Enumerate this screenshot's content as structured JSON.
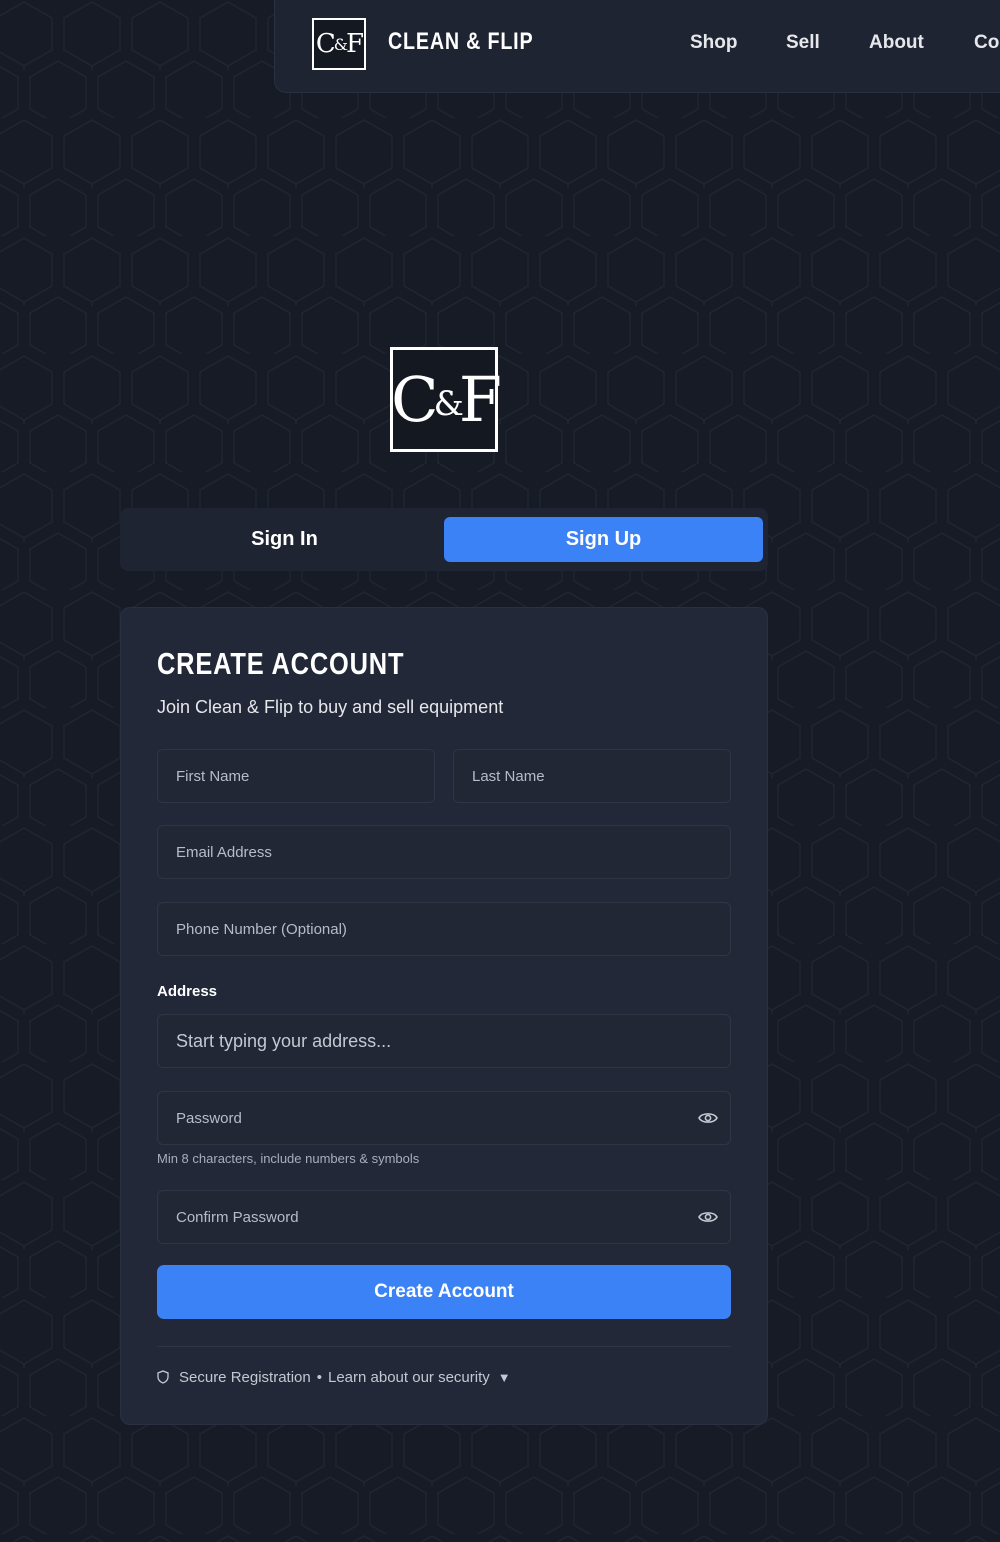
{
  "header": {
    "logo_text": "C&F",
    "brand": "CLEAN & FLIP",
    "nav": [
      {
        "label": "Shop"
      },
      {
        "label": "Sell"
      },
      {
        "label": "About"
      },
      {
        "label": "Contact"
      }
    ]
  },
  "main_logo_text": "C&F",
  "tabs": {
    "signin": "Sign In",
    "signup": "Sign Up",
    "active": "signup"
  },
  "form": {
    "title": "CREATE ACCOUNT",
    "subtitle": "Join Clean & Flip to buy and sell equipment",
    "first_name_placeholder": "First Name",
    "last_name_placeholder": "Last Name",
    "email_placeholder": "Email Address",
    "phone_placeholder": "Phone Number (Optional)",
    "address_label": "Address",
    "address_placeholder": "Start typing your address...",
    "password_placeholder": "Password",
    "password_hint": "Min 8 characters, include numbers & symbols",
    "confirm_placeholder": "Confirm Password",
    "submit_label": "Create Account",
    "secure_text": "Secure Registration",
    "separator": "•",
    "learn_link": "Learn about our security",
    "caret": "▼"
  },
  "colors": {
    "background": "#161b26",
    "surface": "#232838",
    "accent": "#3b82f6"
  },
  "icons": [
    "shield-icon",
    "eye-icon",
    "caret-down-icon"
  ]
}
